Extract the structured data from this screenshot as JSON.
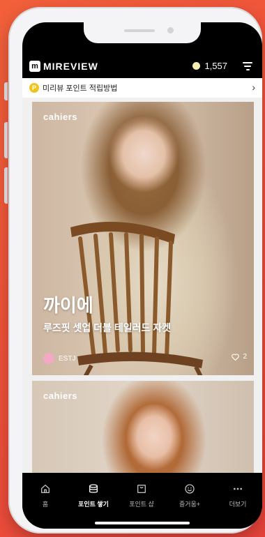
{
  "app": {
    "logo_mark": "m",
    "logo_text": "MIREVIEW",
    "points": "1,557"
  },
  "banner": {
    "coin_glyph": "P",
    "text": "미리뷰 포인트 적립방법",
    "chevron": "›"
  },
  "cards": [
    {
      "brand": "cahiers",
      "title": "까이에",
      "subtitle": "루즈핏 셋업 더블 테일러드 자켓",
      "user": "ESTJ",
      "likes": "2"
    },
    {
      "brand": "cahiers"
    }
  ],
  "tabs": [
    {
      "label": "홈",
      "icon": "home-icon",
      "active": false
    },
    {
      "label": "포인트 쌓기",
      "icon": "coin-stack-icon",
      "active": true
    },
    {
      "label": "포인트 샵",
      "icon": "shopping-bag-icon",
      "active": false
    },
    {
      "label": "즐거움+",
      "icon": "smile-icon",
      "active": false
    },
    {
      "label": "더보기",
      "icon": "more-icon",
      "active": false
    }
  ],
  "colors": {
    "background": "#ef5a3a",
    "coin": "#f1c31e",
    "avatar": "#f3a9c4"
  }
}
